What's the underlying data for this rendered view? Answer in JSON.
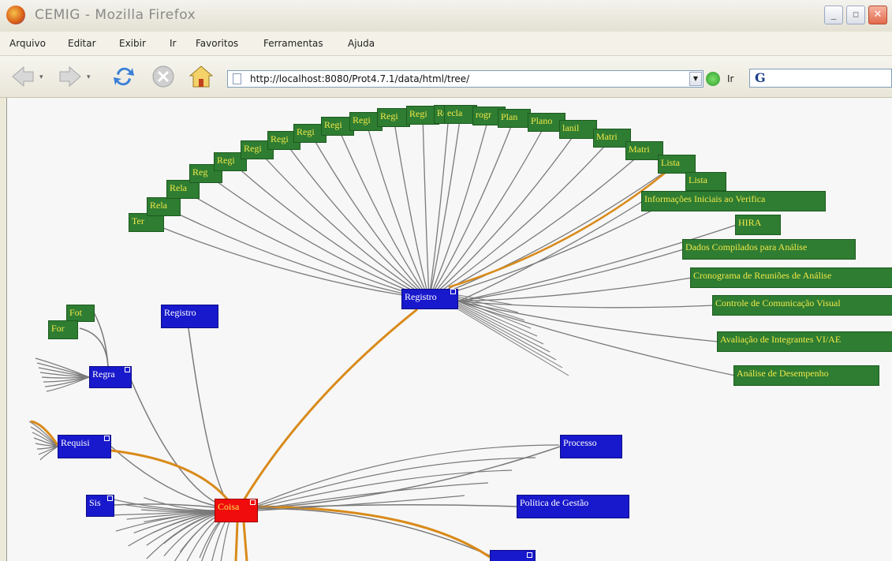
{
  "window": {
    "title": "CEMIG - Mozilla Firefox",
    "controls": [
      "_",
      "▫",
      "✕"
    ]
  },
  "menu": [
    "Arquivo",
    "Editar",
    "Exibir",
    "Ir",
    "Favoritos",
    "Ferramentas",
    "Ajuda"
  ],
  "navbar": {
    "url": "http://localhost:8080/Prot4.7.1/data/html/tree/",
    "go_label": "Ir",
    "search_icon": "G"
  },
  "tree": {
    "fan_nodes": [
      "Ter",
      "Rela",
      "Rela",
      "Reg",
      "Regi",
      "Regi",
      "Regi",
      "Regi",
      "Regi",
      "Regi",
      "Regi",
      "Regi",
      "Regi",
      "ecla",
      "rogr",
      "Plan",
      "Plano",
      "lanil",
      "Matri",
      "Matri",
      "Lista",
      "Lista"
    ],
    "right_nodes": [
      "Informações Iniciais ao Verifica",
      "HIRA",
      "Dados Compilados para Análise",
      "Cronograma de Reuniões de Análise",
      "Controle de Comunicação Visual",
      "Avaliação de Integrantes VI/AE",
      "Análise de Desempenho"
    ],
    "registro_center": "Registro",
    "registro_left": "Registro",
    "regra": "Regra",
    "requisi": "Requisi",
    "sis": "Sis",
    "coisa": "Coisa",
    "processo": "Processo",
    "politica": "Política de Gestão",
    "for": "For",
    "fot": "Fot"
  }
}
